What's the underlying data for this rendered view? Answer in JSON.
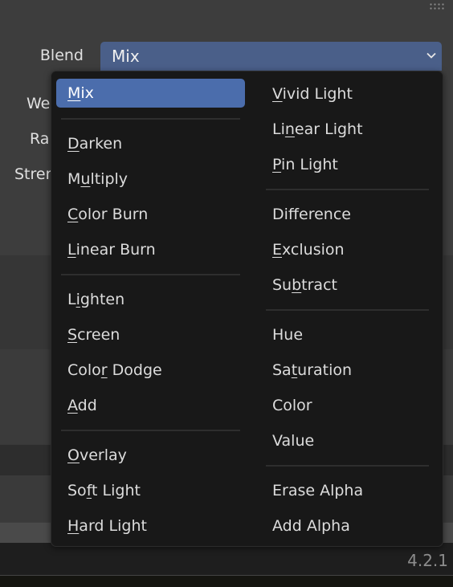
{
  "panel": {
    "labels": {
      "blend": "Blend",
      "weight_partial": "We",
      "radius_partial": "Ra",
      "strength_partial": "Stren"
    },
    "blend_value": "Mix"
  },
  "menu": {
    "left": [
      {
        "label": "Mix",
        "u": 0,
        "active": true
      },
      {
        "sep": true
      },
      {
        "label": "Darken",
        "u": 0
      },
      {
        "label": "Multiply",
        "u": 1
      },
      {
        "label": "Color Burn",
        "u": 0
      },
      {
        "label": "Linear Burn",
        "u": 0
      },
      {
        "sep": true
      },
      {
        "label": "Lighten",
        "u": 1
      },
      {
        "label": "Screen",
        "u": 0
      },
      {
        "label": "Color Dodge",
        "u": 4
      },
      {
        "label": "Add",
        "u": 0
      },
      {
        "sep": true
      },
      {
        "label": "Overlay",
        "u": 0
      },
      {
        "label": "Soft Light",
        "u": 2
      },
      {
        "label": "Hard Light",
        "u": 0
      }
    ],
    "right": [
      {
        "label": "Vivid Light",
        "u": 0
      },
      {
        "label": "Linear Light",
        "u": 2
      },
      {
        "label": "Pin Light",
        "u": 0
      },
      {
        "sep": true
      },
      {
        "label": "Difference",
        "u": -1
      },
      {
        "label": "Exclusion",
        "u": 0
      },
      {
        "label": "Subtract",
        "u": 2
      },
      {
        "sep": true
      },
      {
        "label": "Hue",
        "u": -1
      },
      {
        "label": "Saturation",
        "u": 2
      },
      {
        "label": "Color",
        "u": -1
      },
      {
        "label": "Value",
        "u": -1
      },
      {
        "sep": true
      },
      {
        "label": "Erase Alpha",
        "u": -1
      },
      {
        "label": "Add Alpha",
        "u": -1
      }
    ]
  },
  "status": {
    "version": "4.2.1"
  },
  "colors": {
    "accent": "#4b6dac",
    "dropdown": "#4a5f89",
    "menu_bg": "#181818",
    "panel_bg": "#3d3d3d"
  }
}
